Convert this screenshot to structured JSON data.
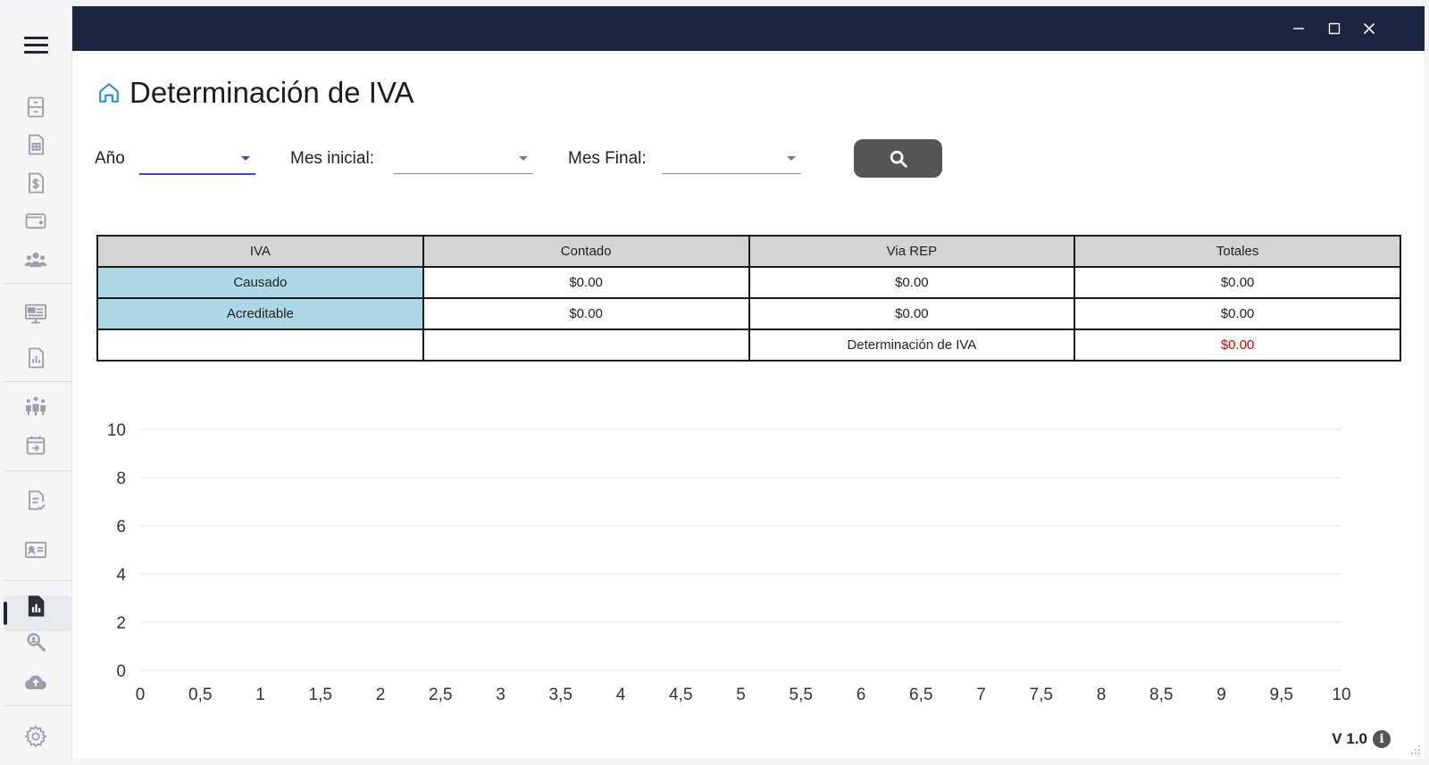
{
  "page": {
    "title": "Determinación de IVA"
  },
  "filters": {
    "year_label": "Año",
    "year_value": "",
    "start_month_label": "Mes inicial:",
    "start_month_value": "",
    "end_month_label": "Mes Final:",
    "end_month_value": ""
  },
  "table": {
    "headers": [
      "IVA",
      "Contado",
      "Via REP",
      "Totales"
    ],
    "rows": [
      [
        "Causado",
        "$0.00",
        "$0.00",
        "$0.00"
      ],
      [
        "Acreditable",
        "$0.00",
        "$0.00",
        "$0.00"
      ],
      [
        "",
        "",
        "Determinación de IVA",
        "$0.00"
      ]
    ]
  },
  "chart_data": {
    "type": "line",
    "series": [],
    "x_ticks": [
      "0",
      "0,5",
      "1",
      "1,5",
      "2",
      "2,5",
      "3",
      "3,5",
      "4",
      "4,5",
      "5",
      "5,5",
      "6",
      "6,5",
      "7",
      "7,5",
      "8",
      "8,5",
      "9",
      "9,5",
      "10"
    ],
    "y_ticks": [
      "0",
      "2",
      "4",
      "6",
      "8",
      "10"
    ],
    "xlim": [
      0,
      10
    ],
    "ylim": [
      0,
      10
    ],
    "grid": true
  },
  "footer": {
    "version": "V 1.0",
    "info_glyph": "i"
  },
  "colors": {
    "titlebar": "#1b2440",
    "accent": "#3a4cc4",
    "row_header": "#add8e6",
    "negative": "#e00000"
  }
}
